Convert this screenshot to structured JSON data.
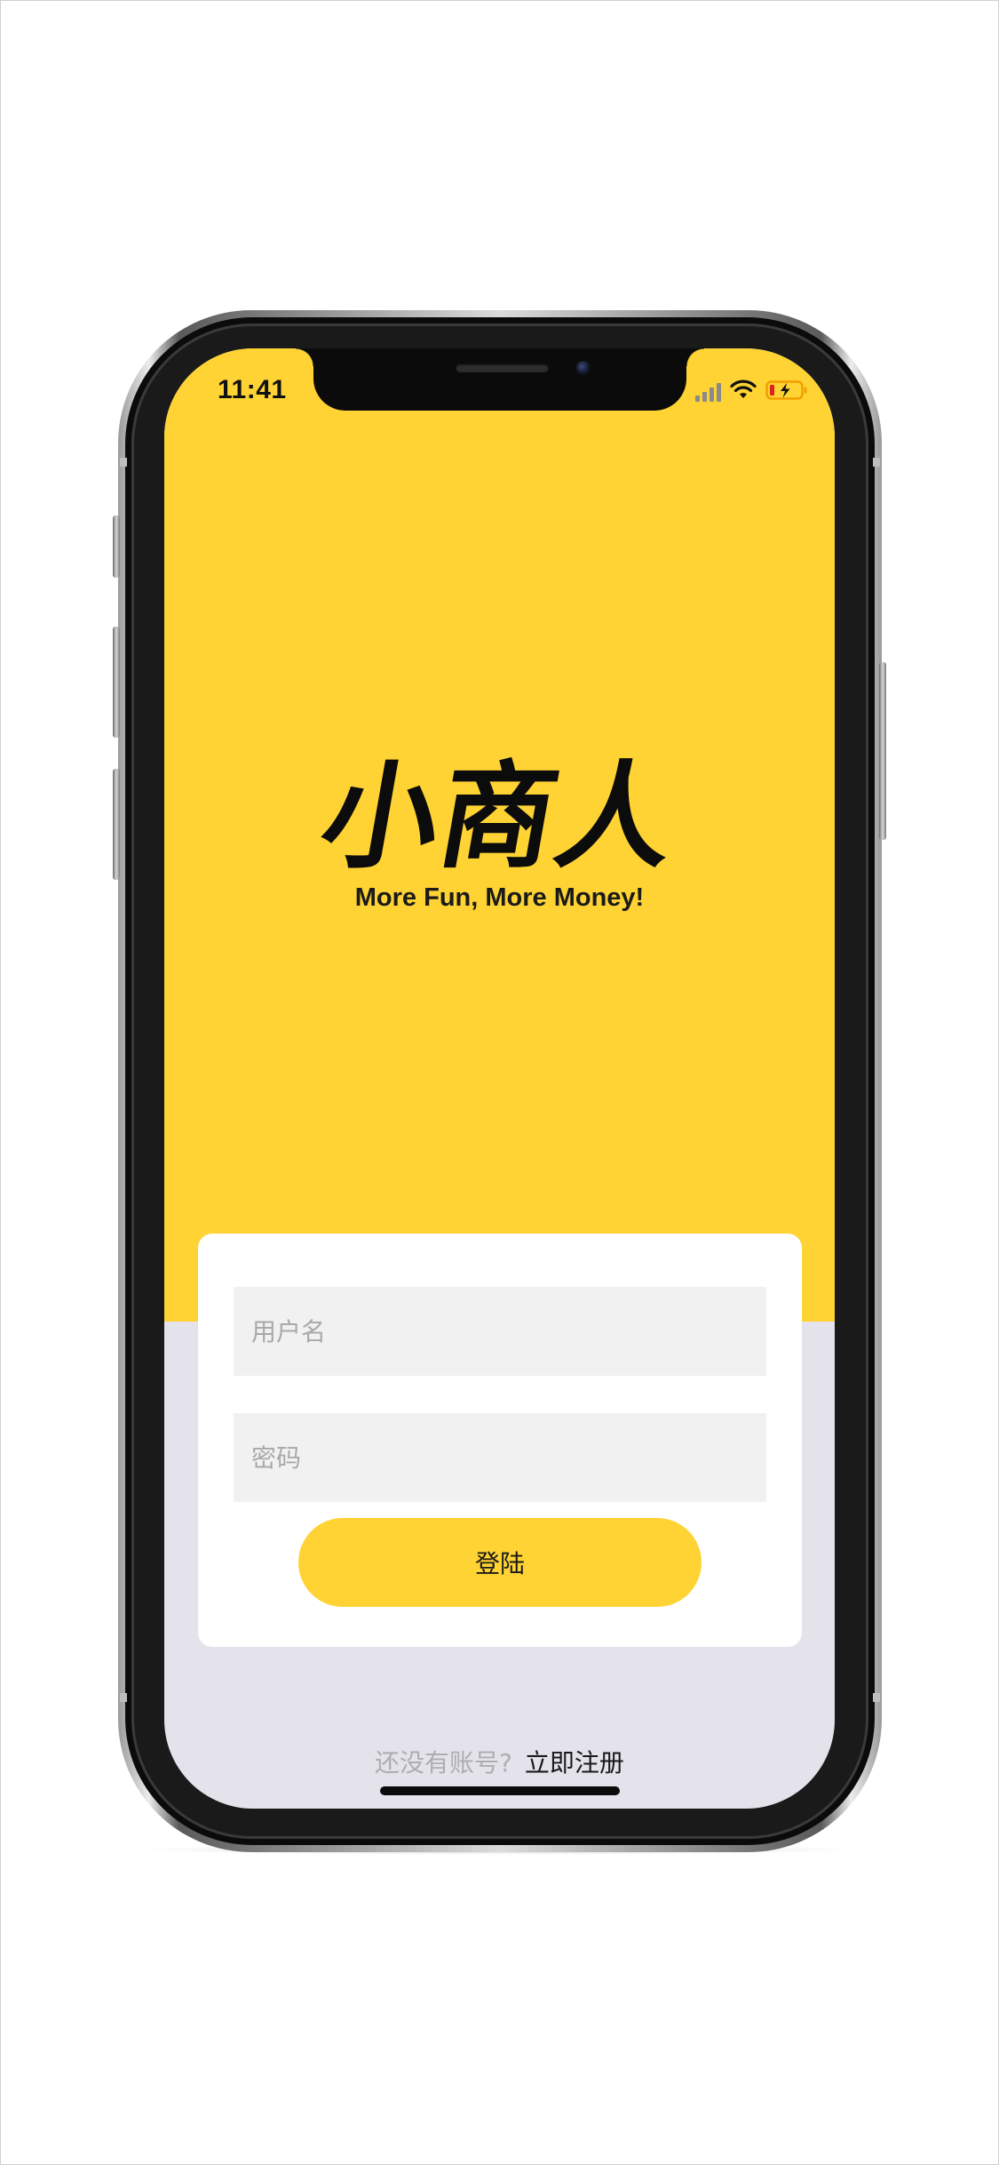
{
  "status_bar": {
    "time": "11:41"
  },
  "brand": {
    "logo_text": "小商人",
    "tagline": "More Fun, More Money!"
  },
  "login_form": {
    "username_placeholder": "用户名",
    "password_placeholder": "密码",
    "login_label": "登陆"
  },
  "register": {
    "prompt": "还没有账号?",
    "link_label": "立即注册"
  },
  "colors": {
    "brand_yellow": "#fed333",
    "bottom_background": "#e4e3ec",
    "input_background": "#f1f1f1",
    "placeholder_gray": "#a9a9a9",
    "battery_charging": "#f0a000",
    "battery_low": "#e02020"
  },
  "icons": {
    "signal": "cellular-signal-icon",
    "wifi": "wifi-icon",
    "battery": "battery-charging-icon"
  }
}
